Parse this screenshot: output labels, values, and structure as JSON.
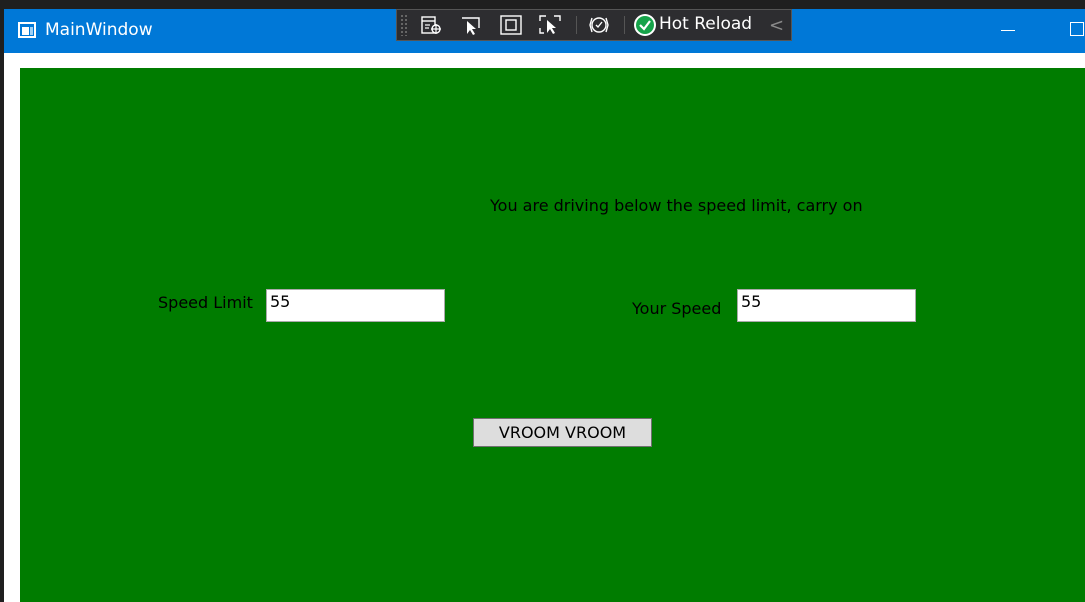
{
  "window": {
    "title": "MainWindow",
    "icon": "app-window-icon",
    "controls": [
      "minimize",
      "maximize"
    ]
  },
  "hot_reload_toolbar": {
    "icons": [
      "live-visual-tree-icon",
      "select-element-icon",
      "display-adorners-icon",
      "track-focus-icon",
      "xaml-binding-icon"
    ],
    "label": "Hot Reload",
    "status_icon": "hot-reload-ok-icon",
    "collapse_glyph": "<"
  },
  "client": {
    "background": "#007c00",
    "status_message": "You are driving below the speed limit, carry on",
    "speed_limit_label": "Speed Limit",
    "speed_limit_value": "55",
    "your_speed_label": "Your Speed",
    "your_speed_value": "55",
    "button_label": "VROOM VROOM"
  }
}
